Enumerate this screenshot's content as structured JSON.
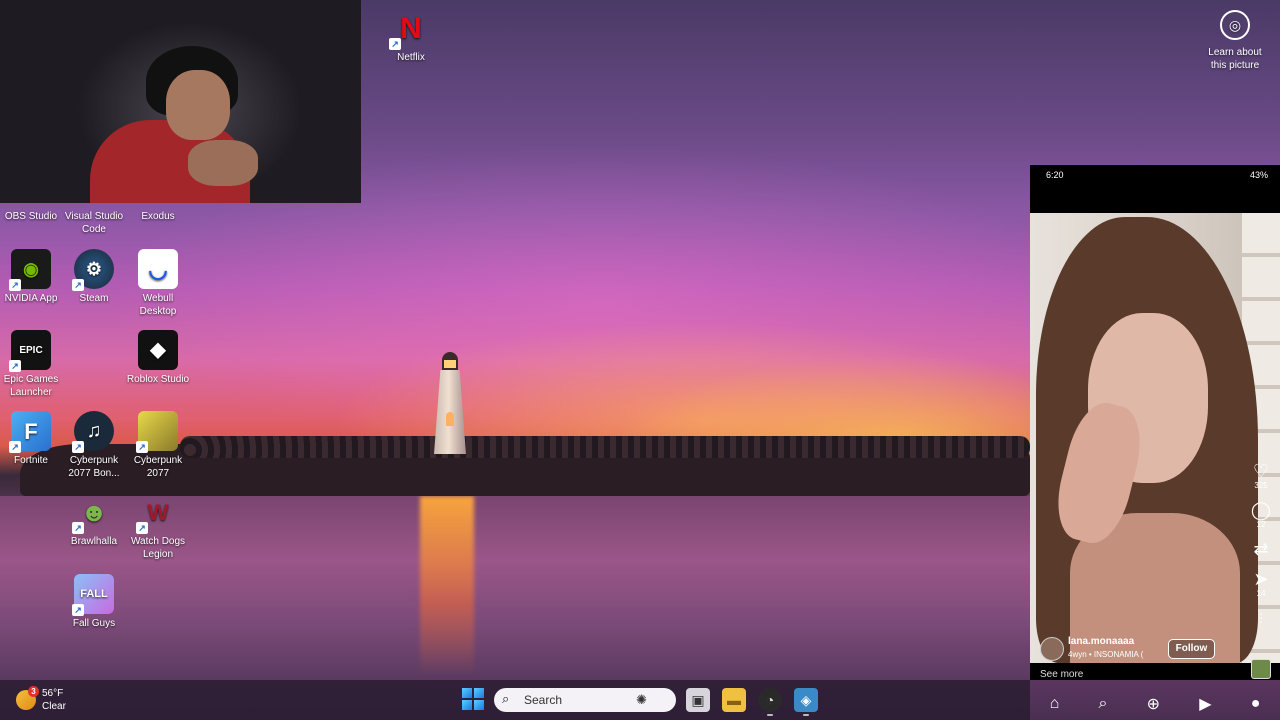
{
  "desktop": {
    "learn_picture": {
      "label_line1": "Learn about",
      "label_line2": "this picture",
      "icon": "camera-lens-icon"
    },
    "icons": [
      {
        "label": "Netflix",
        "icon": "netflix-icon",
        "color": "#e50914"
      },
      {
        "label": "OBS Studio",
        "icon": "obs-icon",
        "color": "#302e31"
      },
      {
        "label": "Visual Studio Code",
        "icon": "vscode-icon",
        "color": "#0065a9"
      },
      {
        "label": "Exodus",
        "icon": "exodus-icon",
        "color": "#1a1d3a"
      },
      {
        "label": "NVIDIA App",
        "icon": "nvidia-icon",
        "color": "#76b900"
      },
      {
        "label": "Steam",
        "icon": "steam-icon",
        "color": "#1b2838"
      },
      {
        "label": "Webull Desktop",
        "icon": "webull-icon",
        "color": "#ffffff"
      },
      {
        "label": "Epic Games Launcher",
        "icon": "epic-games-icon",
        "color": "#121212"
      },
      {
        "label": "Roblox Studio",
        "icon": "roblox-icon",
        "color": "#111111"
      },
      {
        "label": "Fortnite",
        "icon": "fortnite-icon",
        "color": "#3aa0e8"
      },
      {
        "label": "Cyberpunk 2077 Bon...",
        "icon": "music-note-icon",
        "color": "#1a2a3a"
      },
      {
        "label": "Cyberpunk 2077",
        "icon": "cyberpunk-icon",
        "color": "#e8d84a"
      },
      {
        "label": "Brawlhalla",
        "icon": "brawlhalla-icon",
        "color": "#5a8a3a"
      },
      {
        "label": "Watch Dogs Legion",
        "icon": "watch-dogs-icon",
        "color": "#7a1a2a"
      },
      {
        "label": "Fall Guys",
        "icon": "fall-guys-icon",
        "color": "#6aa0e8"
      }
    ]
  },
  "phone": {
    "status": {
      "time": "6:20",
      "battery": "43%"
    },
    "actions": {
      "likes": "325",
      "comments": "12",
      "shares": "14"
    },
    "author": {
      "username": "lana.monaaaa",
      "music": "4wyn • INSONAMIA ("
    },
    "follow_label": "Follow",
    "see_more": "See more"
  },
  "taskbar": {
    "weather": {
      "temp": "56°F",
      "condition": "Clear",
      "badge": "3"
    },
    "search_placeholder": "Search"
  },
  "colors": {
    "taskbar_bg": "#281c30",
    "accent_blue": "#1a7ae0",
    "notification_red": "#e0322a"
  }
}
